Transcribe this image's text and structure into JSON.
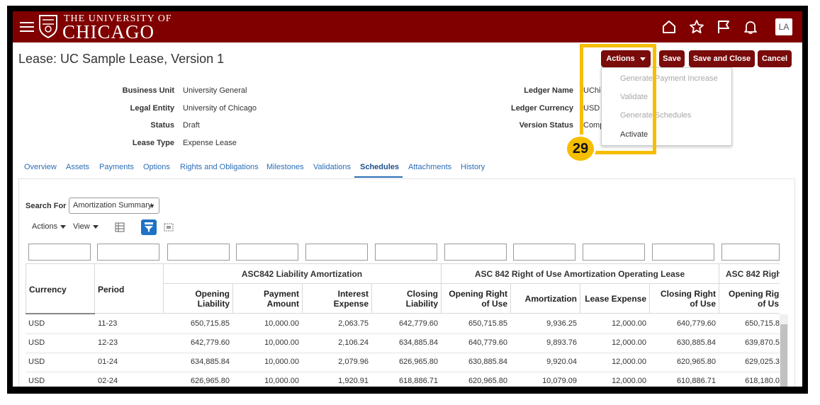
{
  "header": {
    "logo_top": "THE UNIVERSITY OF",
    "logo_main": "CHICAGO",
    "avatar": "LA"
  },
  "page": {
    "title": "Lease: UC Sample Lease, Version 1"
  },
  "buttons": {
    "actions": "Actions",
    "save": "Save",
    "save_close": "Save and Close",
    "cancel": "Cancel"
  },
  "fields_left": [
    {
      "label": "Business Unit",
      "value": "University General"
    },
    {
      "label": "Legal Entity",
      "value": "University of Chicago"
    },
    {
      "label": "Status",
      "value": "Draft"
    },
    {
      "label": "Lease Type",
      "value": "Expense Lease"
    }
  ],
  "fields_right": [
    {
      "label": "Ledger Name",
      "value": "UChic"
    },
    {
      "label": "Ledger Currency",
      "value": "USD"
    },
    {
      "label": "Version Status",
      "value": "Comp"
    }
  ],
  "tabs": [
    "Overview",
    "Assets",
    "Payments",
    "Options",
    "Rights and Obligations",
    "Milestones",
    "Validations",
    "Schedules",
    "Attachments",
    "History"
  ],
  "search": {
    "label": "Search For",
    "value": "Amortization Summary"
  },
  "toolbar": {
    "actions": "Actions",
    "view": "View"
  },
  "table": {
    "col_currency": "Currency",
    "col_period": "Period",
    "groups": [
      "ASC842 Liability Amortization",
      "ASC 842 Right of Use Amortization Operating Lease",
      "ASC 842 Righ"
    ],
    "subcols": [
      [
        "Opening",
        "Liability"
      ],
      [
        "Payment",
        "Amount"
      ],
      [
        "Interest",
        "Expense"
      ],
      [
        "Closing",
        "Liability"
      ],
      [
        "Opening Right",
        "of Use"
      ],
      [
        "Amortization",
        ""
      ],
      [
        "Lease Expense",
        ""
      ],
      [
        "Closing Right",
        "of Use"
      ],
      [
        "Opening Righ",
        "of Us"
      ]
    ],
    "rows": [
      [
        "USD",
        "11-23",
        "650,715.85",
        "10,000.00",
        "2,063.75",
        "642,779.60",
        "650,715.85",
        "9,936.25",
        "12,000.00",
        "640,779.60",
        "650,715.8"
      ],
      [
        "USD",
        "12-23",
        "642,779.60",
        "10,000.00",
        "2,106.24",
        "634,885.84",
        "640,779.60",
        "9,893.76",
        "12,000.00",
        "630,885.84",
        "639,870.5"
      ],
      [
        "USD",
        "01-24",
        "634,885.84",
        "10,000.00",
        "2,079.96",
        "626,965.80",
        "630,885.84",
        "9,920.04",
        "12,000.00",
        "620,965.80",
        "629,025.3"
      ],
      [
        "USD",
        "02-24",
        "626,965.80",
        "10,000.00",
        "1,920.91",
        "618,886.71",
        "620,965.80",
        "10,079.09",
        "12,000.00",
        "610,886.71",
        "618,180.0"
      ]
    ]
  },
  "menu": {
    "items": [
      {
        "pre": "Generate ",
        "post": "Payment Increase",
        "enabled": false
      },
      {
        "pre": "Validate",
        "post": "",
        "enabled": false
      },
      {
        "pre": "Generate ",
        "post": "Schedules",
        "enabled": false
      },
      {
        "pre": "Activate",
        "post": "",
        "enabled": true
      }
    ]
  },
  "callout": {
    "number": "29",
    "color": "#f5be00"
  },
  "colors": {
    "brand": "#800000",
    "button": "#7a0b0b",
    "link": "#2a6db5"
  }
}
